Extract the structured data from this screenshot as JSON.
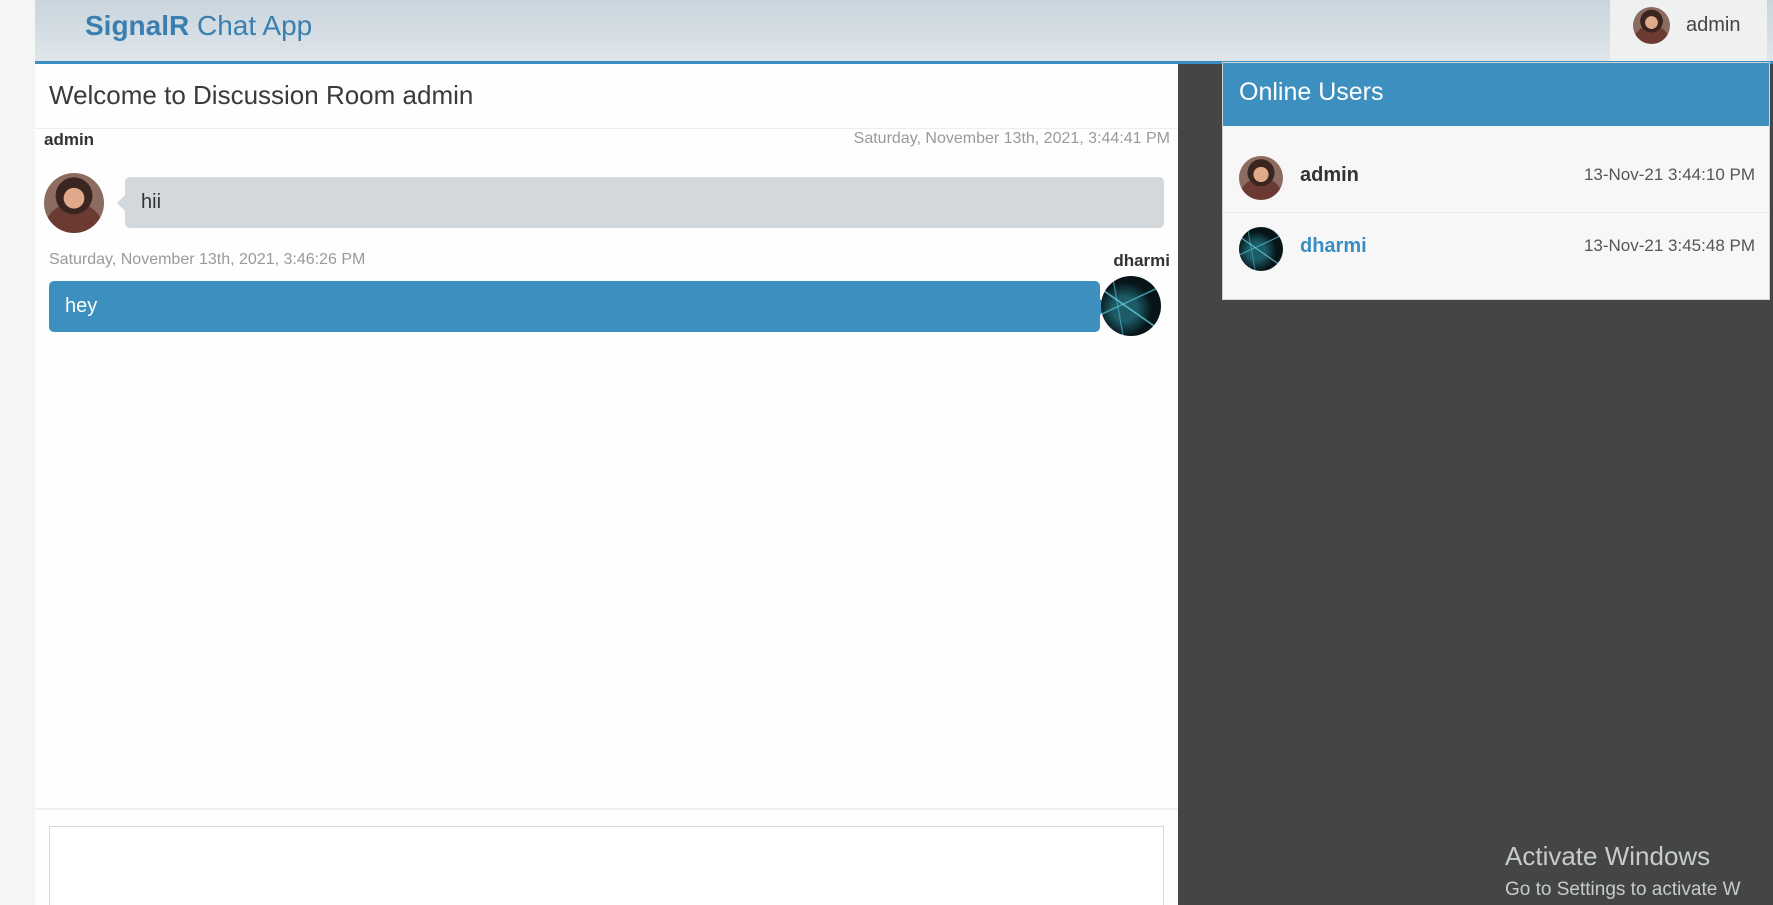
{
  "navbar": {
    "brand_bold": "SignalR",
    "brand_rest": " Chat App",
    "user_name": "admin"
  },
  "chat": {
    "room_title": "Welcome to Discussion Room admin",
    "messages": [
      {
        "author": "admin",
        "time": "Saturday, November 13th, 2021, 3:44:41 PM",
        "text": "hii",
        "side": "left"
      },
      {
        "author": "dharmi",
        "time": "Saturday, November 13th, 2021, 3:46:26 PM",
        "text": "hey",
        "side": "right"
      }
    ],
    "composer_value": ""
  },
  "online_users": {
    "title": "Online Users",
    "users": [
      {
        "name": "admin",
        "time": "13-Nov-21 3:44:10 PM",
        "name_color": "#333333"
      },
      {
        "name": "dharmi",
        "time": "13-Nov-21 3:45:48 PM",
        "name_color": "#3b8ec2"
      }
    ]
  },
  "watermark": {
    "line1": "Activate Windows",
    "line2": "Go to Settings to activate W"
  },
  "colors": {
    "accent": "#3d8fc0",
    "dark_panel": "#434643"
  }
}
